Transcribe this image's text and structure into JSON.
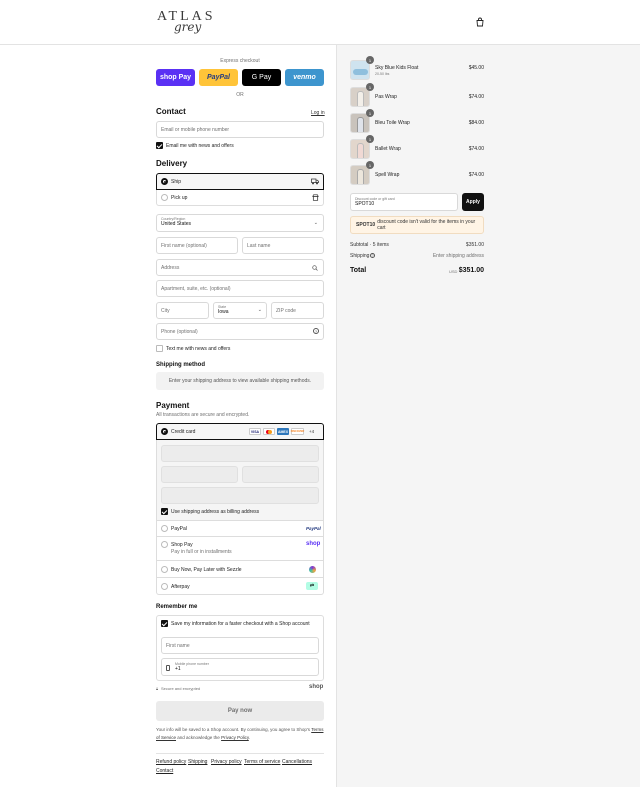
{
  "header": {
    "logo_main": "ATLAS",
    "logo_sub": "grey",
    "cart_icon": "shopping-bag-icon"
  },
  "express": {
    "title": "Express checkout",
    "buttons": [
      {
        "label": "shop Pay",
        "bg": "#5a31f4",
        "fg": "#ffffff"
      },
      {
        "label": "PayPal",
        "bg": "#ffc439",
        "fg": "#253b80"
      },
      {
        "label": "G Pay",
        "bg": "#000000",
        "fg": "#ffffff"
      },
      {
        "label": "venmo",
        "bg": "#3d95ce",
        "fg": "#ffffff"
      }
    ],
    "or": "OR"
  },
  "contact": {
    "title": "Contact",
    "login": "Log in",
    "email_placeholder": "Email or mobile phone number",
    "news": "Email me with news and offers"
  },
  "delivery": {
    "title": "Delivery",
    "ship": "Ship",
    "pickup": "Pick up",
    "country_label": "Country/Region",
    "country_value": "United States",
    "first_name": "First name (optional)",
    "last_name": "Last name",
    "address": "Address",
    "apartment": "Apartment, suite, etc. (optional)",
    "city": "City",
    "state_label": "State",
    "state_value": "Iowa",
    "zip": "ZIP code",
    "phone": "Phone (optional)",
    "text_news": "Text me with news and offers"
  },
  "shipping_method": {
    "title": "Shipping method",
    "note": "Enter your shipping address to view available shipping methods."
  },
  "payment": {
    "title": "Payment",
    "subtitle": "All transactions are secure and encrypted.",
    "credit_card": "Credit card",
    "cards": [
      {
        "label": "VISA",
        "bg": "#ffffff",
        "fg": "#1a1f71"
      },
      {
        "label": "MC",
        "bg": "#ffffff",
        "fg": "#eb001b"
      },
      {
        "label": "AMEX",
        "bg": "#2e77bb",
        "fg": "#ffffff"
      },
      {
        "label": "DISCOVER",
        "bg": "#ffffff",
        "fg": "#f58220"
      }
    ],
    "more_cards": "+4",
    "billing_same": "Use shipping address as billing address",
    "paypal": "PayPal",
    "paypal_logo": "PayPal",
    "shoppay": "Shop Pay",
    "shoppay_sub": "Pay in full or in installments",
    "shoppay_logo": "shop",
    "sezzle": "Buy Now, Pay Later with Sezzle",
    "afterpay": "Afterpay"
  },
  "remember": {
    "title": "Remember me",
    "save": "Save my information for a faster checkout with a Shop account",
    "first_name": "First name",
    "mobile_label": "Mobile phone number",
    "mobile_value": "+1",
    "secure": "Secure and encrypted",
    "shop_logo": "shop"
  },
  "pay_now": "Pay now",
  "legal": {
    "text1": "Your info will be saved to a Shop account. By continuing, you agree to Shop's",
    "tos": "Terms of Service",
    "and": "and acknowledge the",
    "privacy": "Privacy Policy",
    "end": "."
  },
  "footer_links": [
    "Refund policy",
    "Shipping",
    "Privacy policy",
    "Terms of service",
    "Cancellations",
    "Contact"
  ],
  "cart": {
    "items": [
      {
        "qty": "1",
        "name": "Sky Blue Kids Float",
        "variant": "20-50 lbs",
        "price": "$45.00",
        "color": "#cfe3ef"
      },
      {
        "qty": "1",
        "name": "Pas Wrap",
        "variant": "",
        "price": "$74.00",
        "color": "#d8d0c8"
      },
      {
        "qty": "1",
        "name": "Bleu Toile Wrap",
        "variant": "",
        "price": "$84.00",
        "color": "#c9c3bc"
      },
      {
        "qty": "1",
        "name": "Ballet Wrap",
        "variant": "",
        "price": "$74.00",
        "color": "#e2d6cc"
      },
      {
        "qty": "1",
        "name": "Spell Wrap",
        "variant": "",
        "price": "$74.00",
        "color": "#d4ccc2"
      }
    ],
    "discount_label": "Discount code or gift card",
    "discount_value": "SPOT10",
    "apply": "Apply",
    "error_code": "SPOT10",
    "error_text": "discount code isn't valid for the items in your cart",
    "subtotal_label": "Subtotal · 5 items",
    "subtotal_value": "$351.00",
    "shipping_label": "Shipping",
    "shipping_value": "Enter shipping address",
    "total_label": "Total",
    "currency": "USD",
    "total_value": "$351.00"
  }
}
